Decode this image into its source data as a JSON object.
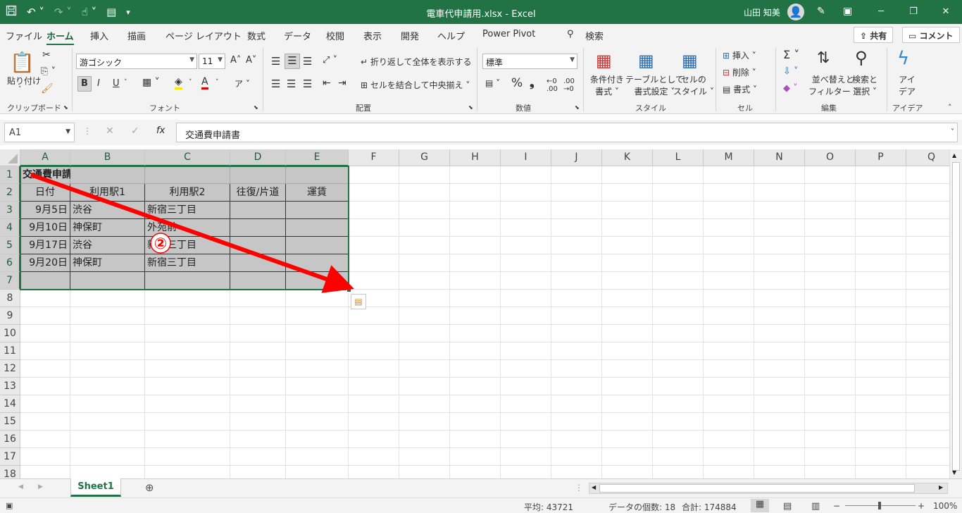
{
  "titlebar": {
    "title": "電車代申請用.xlsx  -  Excel",
    "user": "山田 知美",
    "qat_icons": [
      "save-icon",
      "undo-icon",
      "redo-icon",
      "touch-mode-icon",
      "form-icon",
      "customize-qat-icon"
    ]
  },
  "menu": {
    "tabs": [
      "ファイル",
      "ホーム",
      "挿入",
      "描画",
      "ページ レイアウト",
      "数式",
      "データ",
      "校閲",
      "表示",
      "開発",
      "ヘルプ",
      "Power Pivot"
    ],
    "active": "ホーム",
    "search_label": "検索",
    "share": "共有",
    "comment": "コメント"
  },
  "ribbon": {
    "clipboard": {
      "paste": "貼り付け",
      "label": "クリップボード"
    },
    "font": {
      "name": "游ゴシック",
      "size": "11",
      "label": "フォント",
      "bold": "B",
      "italic": "I",
      "underline": "U"
    },
    "alignment": {
      "wrap": "折り返して全体を表示する",
      "merge": "セルを結合して中央揃え",
      "label": "配置"
    },
    "number": {
      "format": "標準",
      "label": "数値"
    },
    "styles": {
      "conditional": [
        "条件付き",
        "書式"
      ],
      "table": [
        "テーブルとして",
        "書式設定"
      ],
      "cell": [
        "セルの",
        "スタイル"
      ],
      "label": "スタイル"
    },
    "cells": {
      "insert": "挿入",
      "delete": "削除",
      "format": "書式",
      "label": "セル"
    },
    "editing": {
      "sort": [
        "並べ替えと",
        "フィルター"
      ],
      "find": [
        "検索と",
        "選択"
      ],
      "label": "編集"
    },
    "ideas": {
      "button": [
        "アイ",
        "デア"
      ],
      "label": "アイデア"
    }
  },
  "formula_bar": {
    "name_box": "A1",
    "content": "交通費申請書"
  },
  "columns": [
    "A",
    "B",
    "C",
    "D",
    "E",
    "F",
    "G",
    "H",
    "I",
    "J",
    "K",
    "L",
    "M",
    "N",
    "O",
    "P",
    "Q"
  ],
  "rows": [
    "1",
    "2",
    "3",
    "4",
    "5",
    "6",
    "7",
    "8",
    "9",
    "10",
    "11",
    "12",
    "13",
    "14",
    "15",
    "16",
    "17",
    "18"
  ],
  "sheet": {
    "title": "交通費申請書",
    "headers": [
      "日付",
      "利用駅1",
      "利用駅2",
      "往復/片道",
      "運賃"
    ],
    "data": [
      [
        "9月5日",
        "渋谷",
        "新宿三丁目",
        "",
        ""
      ],
      [
        "9月10日",
        "神保町",
        "外苑前",
        "",
        ""
      ],
      [
        "9月17日",
        "渋谷",
        "新宿三丁目",
        "",
        ""
      ],
      [
        "9月20日",
        "神保町",
        "新宿三丁目",
        "",
        ""
      ],
      [
        "",
        "",
        "",
        "",
        ""
      ]
    ]
  },
  "annotation": {
    "step": "②",
    "color": "#ff0000"
  },
  "sheet_tabs": [
    "Sheet1"
  ],
  "status": {
    "average": "平均: 43721",
    "count": "データの個数: 18",
    "sum": "合計: 174884",
    "zoom": "100%"
  },
  "colors": {
    "accent": "#217346",
    "selection": "#c6c6c6"
  }
}
